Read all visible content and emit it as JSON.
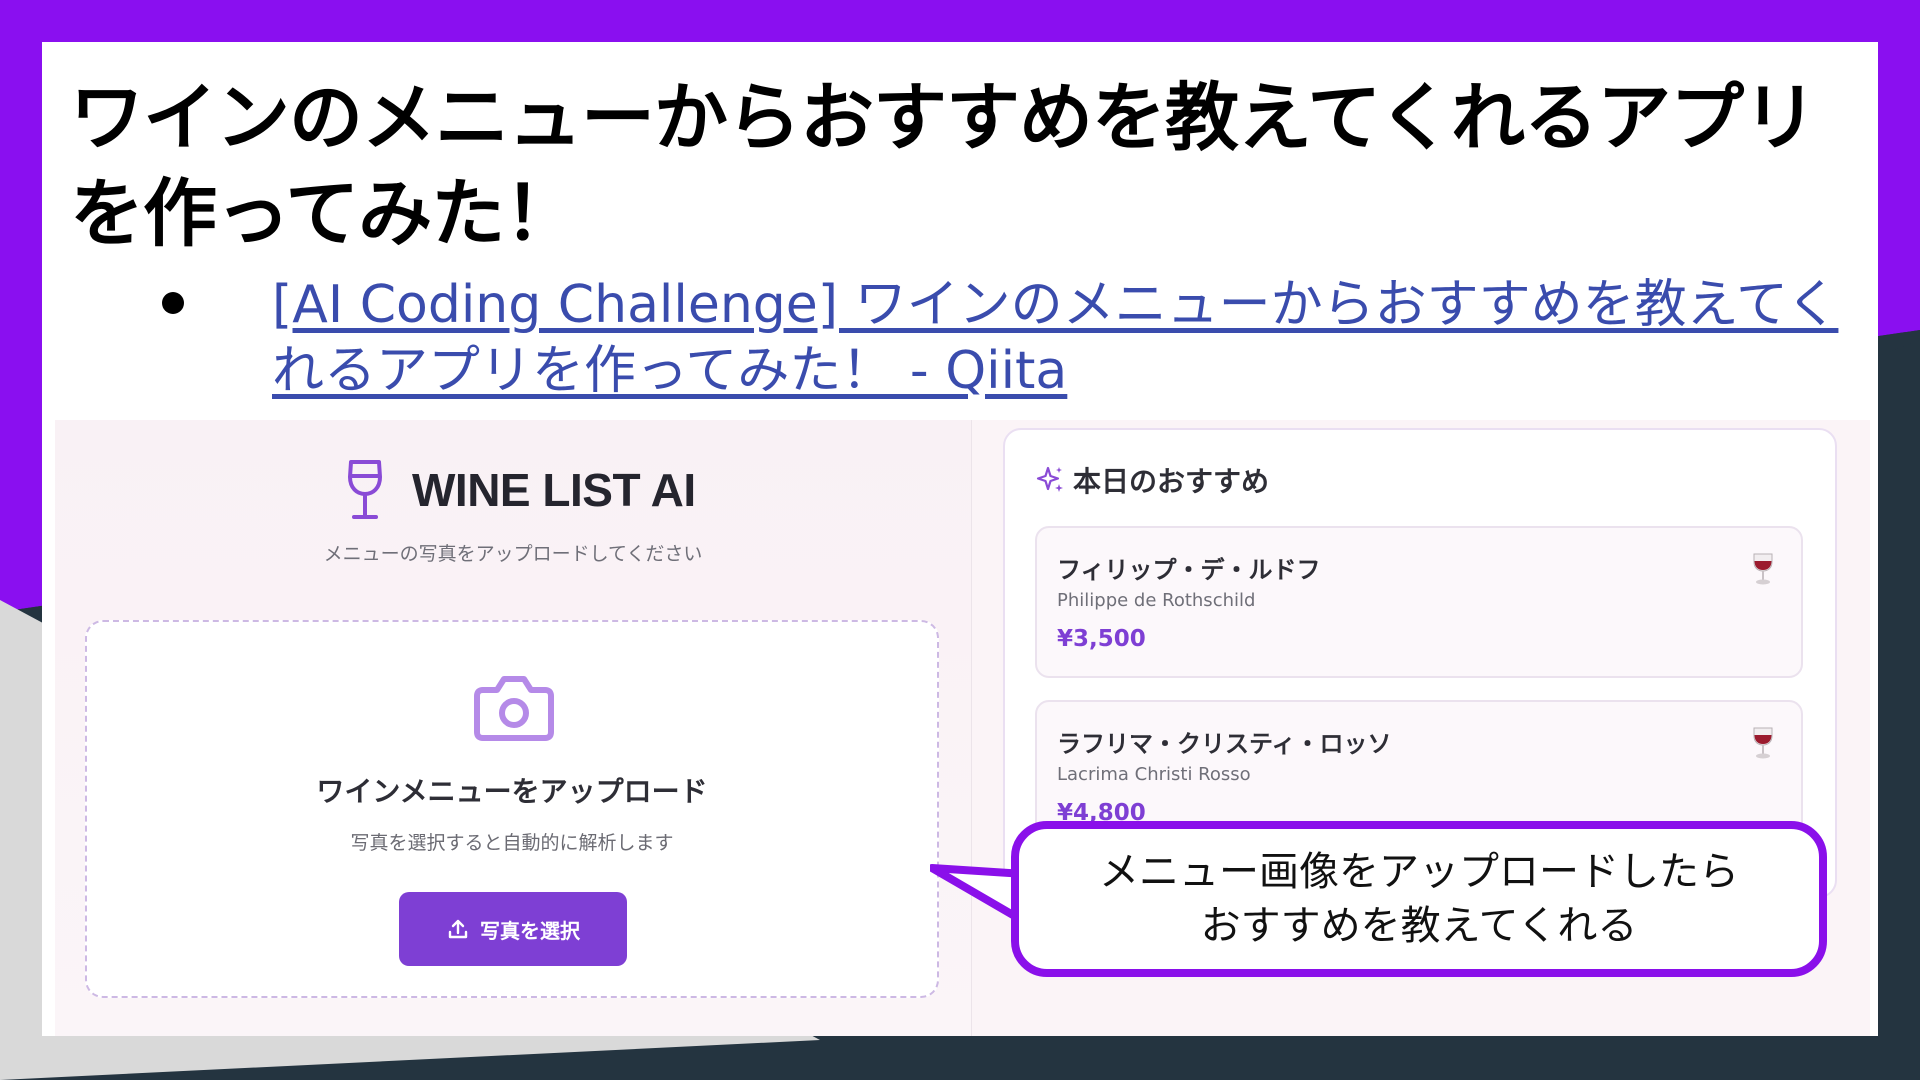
{
  "slide": {
    "title": "ワインのメニューからおすすめを教えてくれるアプリを作ってみた！",
    "bullet_link": "[AI Coding Challenge] ワインのメニューからおすすめを教えてくれるアプリを作ってみた！ - Qiita"
  },
  "app": {
    "brand_name": "WINE LIST AI",
    "brand_icon": "wine-glass-icon",
    "subtitle": "メニューの写真をアップロードしてください",
    "upload": {
      "icon": "camera-icon",
      "title": "ワインメニューをアップロード",
      "hint": "写真を選択すると自動的に解析します",
      "button_icon": "upload-icon",
      "button_label": "写真を選択"
    },
    "recommendations": {
      "icon": "sparkle-icon",
      "title": "本日のおすすめ",
      "items": [
        {
          "name_ja": "フィリップ・デ・ルドフ",
          "name_en": "Philippe de Rothschild",
          "price": "¥3,500",
          "icon": "red-wine-glass-icon"
        },
        {
          "name_ja": "ラフリマ・クリスティ・ロッソ",
          "name_en": "Lacrima Christi Rosso",
          "price": "¥4,800",
          "icon": "red-wine-glass-icon"
        }
      ]
    }
  },
  "callout": {
    "line1": "メニュー画像をアップロードしたら",
    "line2": "おすすめを教えてくれる"
  },
  "colors": {
    "accent_purple": "#8a10ea",
    "button_purple": "#7e3fd4",
    "link_blue": "#3a4cad",
    "dark_bg": "#243440"
  }
}
